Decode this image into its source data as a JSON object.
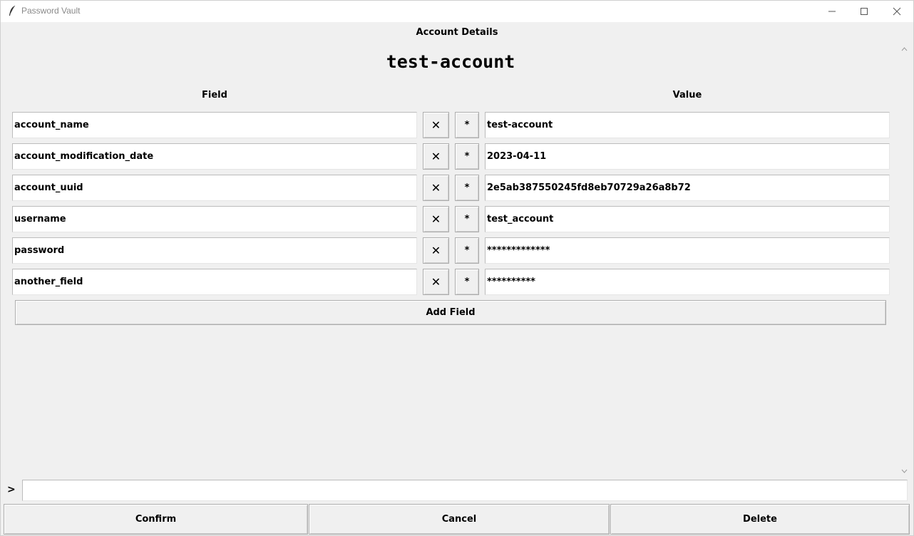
{
  "window": {
    "title": "Password Vault",
    "icon": "feather-icon",
    "controls": [
      "minimize-icon",
      "maximize-icon",
      "close-icon"
    ]
  },
  "section_title": "Account Details",
  "account_heading": "test-account",
  "columns": {
    "field": "Field",
    "value": "Value"
  },
  "rows": [
    {
      "field": "account_name",
      "value": "test-account",
      "delete_label": "✕",
      "mask_label": "*"
    },
    {
      "field": "account_modification_date",
      "value": "2023-04-11",
      "delete_label": "✕",
      "mask_label": "*"
    },
    {
      "field": "account_uuid",
      "value": "2e5ab387550245fd8eb70729a26a8b72",
      "delete_label": "✕",
      "mask_label": "*"
    },
    {
      "field": "username",
      "value": "test_account",
      "delete_label": "✕",
      "mask_label": "*"
    },
    {
      "field": "password",
      "value": "*************",
      "delete_label": "✕",
      "mask_label": "*"
    },
    {
      "field": "another_field",
      "value": "**********",
      "delete_label": "✕",
      "mask_label": "*"
    }
  ],
  "add_field_label": "Add Field",
  "command": {
    "prompt": ">",
    "value": ""
  },
  "actions": {
    "confirm": "Confirm",
    "cancel": "Cancel",
    "delete": "Delete"
  }
}
